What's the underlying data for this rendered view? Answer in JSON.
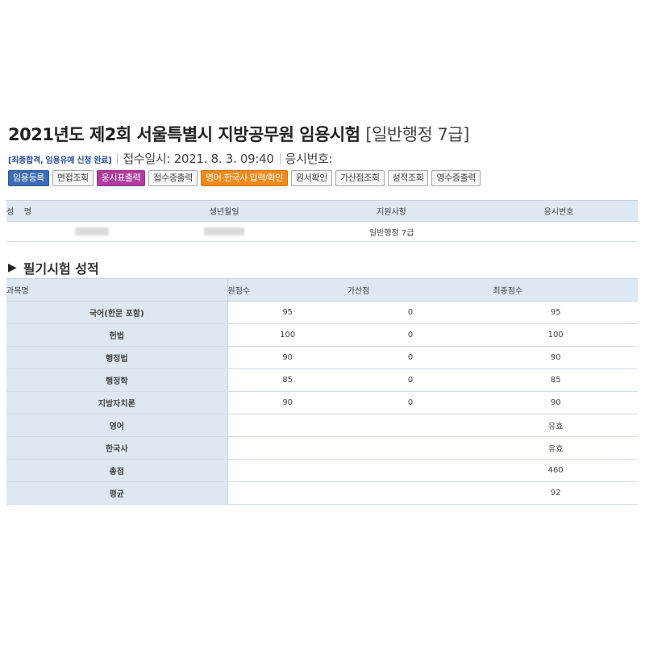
{
  "header": {
    "title": "2021년도 제2회 서울특별시 지방공무원 임용시험",
    "category": "[일반행정 7급]"
  },
  "status": {
    "badge": "[최종합격, 임용유예 신청 완료]",
    "received": "접수일시: 2021. 8. 3. 09:40",
    "exam_number_label": "응시번호:"
  },
  "toolbar": {
    "buttons": [
      {
        "label": "임용등록",
        "style": "blue"
      },
      {
        "label": "면접조회",
        "style": "default"
      },
      {
        "label": "응시표출력",
        "style": "purple"
      },
      {
        "label": "접수증출력",
        "style": "default"
      },
      {
        "label": "영어·한국사 입력/확인",
        "style": "orange"
      },
      {
        "label": "원서확인",
        "style": "default"
      },
      {
        "label": "가산점조회",
        "style": "default"
      },
      {
        "label": "성적조회",
        "style": "default"
      },
      {
        "label": "영수증출력",
        "style": "default"
      }
    ]
  },
  "applicant_table": {
    "headers": {
      "name": "성    명",
      "birth": "생년월일",
      "field": "지원사항",
      "exam_no": "응시번호"
    },
    "row": {
      "field": "일반행정 7급"
    }
  },
  "section": {
    "title": "필기시험 성적"
  },
  "scores_table": {
    "headers": {
      "subject": "과목명",
      "raw": "원점수",
      "bonus": "가산점",
      "final": "최종점수"
    },
    "rows": [
      {
        "subject": "국어(한문 포함)",
        "raw": "95",
        "bonus": "0",
        "final": "95"
      },
      {
        "subject": "헌법",
        "raw": "100",
        "bonus": "0",
        "final": "100"
      },
      {
        "subject": "행정법",
        "raw": "90",
        "bonus": "0",
        "final": "90"
      },
      {
        "subject": "행정학",
        "raw": "85",
        "bonus": "0",
        "final": "85"
      },
      {
        "subject": "지방자치론",
        "raw": "90",
        "bonus": "0",
        "final": "90"
      },
      {
        "subject": "영어",
        "raw": "",
        "bonus": "",
        "final": "유효"
      },
      {
        "subject": "한국사",
        "raw": "",
        "bonus": "",
        "final": "유효"
      },
      {
        "subject": "총점",
        "raw": "",
        "bonus": "",
        "final": "460"
      },
      {
        "subject": "평균",
        "raw": "",
        "bonus": "",
        "final": "92"
      }
    ]
  }
}
